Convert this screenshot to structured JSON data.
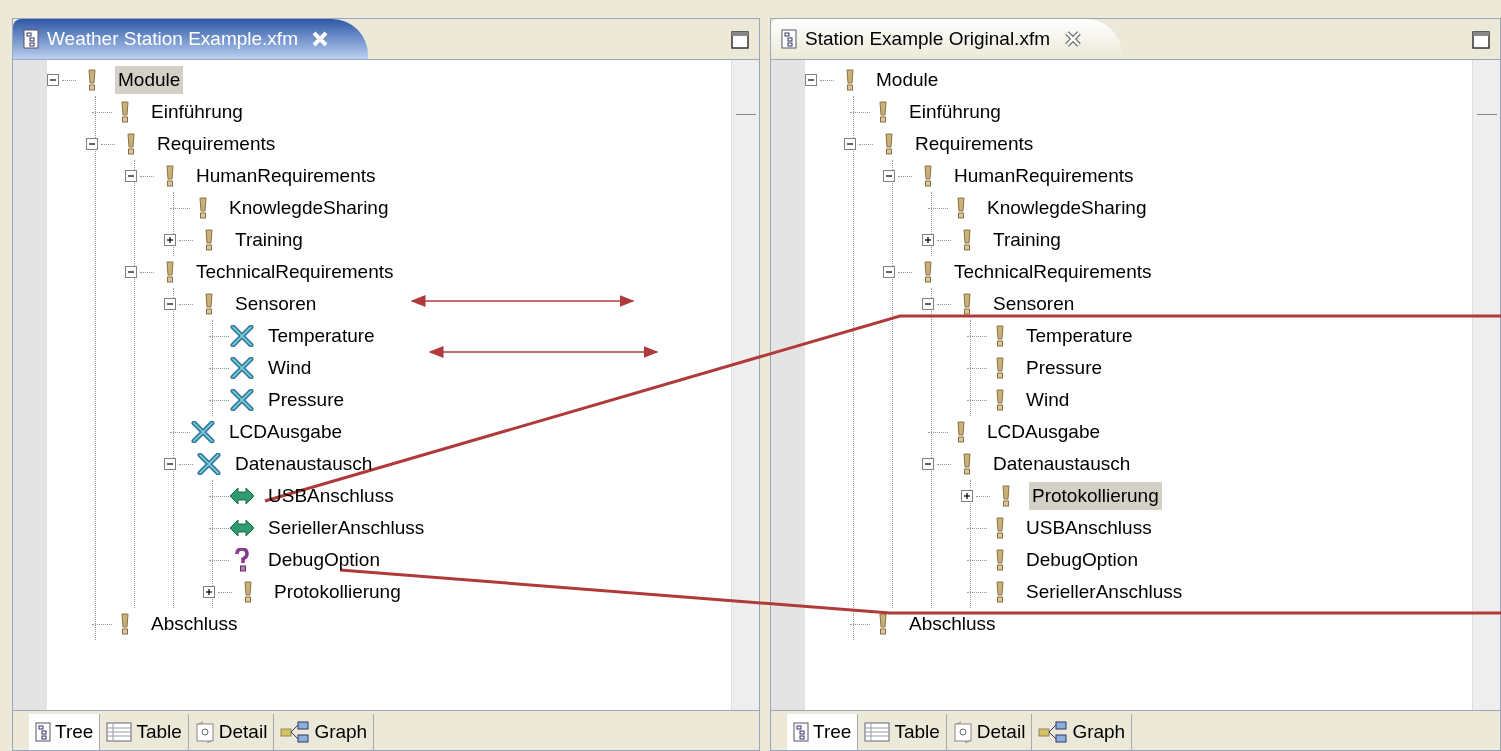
{
  "panels": [
    {
      "title": "Weather Station Example.xfm",
      "active": true,
      "tree": [
        {
          "label": "Module",
          "kind": "mandatory",
          "expanded": true,
          "selected": true,
          "children": [
            {
              "label": "Einführung",
              "kind": "mandatory",
              "selected": false
            },
            {
              "label": "Requirements",
              "kind": "mandatory",
              "expanded": true,
              "selected": false,
              "children": [
                {
                  "label": "HumanRequirements",
                  "kind": "mandatory",
                  "expanded": true,
                  "selected": false,
                  "children": [
                    {
                      "label": "KnowlegdeSharing",
                      "kind": "mandatory",
                      "selected": false
                    },
                    {
                      "label": "Training",
                      "kind": "mandatory",
                      "expanded": false,
                      "selected": false
                    }
                  ]
                },
                {
                  "label": "TechnicalRequirements",
                  "kind": "mandatory",
                  "expanded": true,
                  "selected": false,
                  "children": [
                    {
                      "label": "Sensoren",
                      "kind": "mandatory",
                      "expanded": true,
                      "selected": false,
                      "children": [
                        {
                          "label": "Temperature",
                          "kind": "removed",
                          "selected": false
                        },
                        {
                          "label": "Wind",
                          "kind": "removed",
                          "selected": false
                        },
                        {
                          "label": "Pressure",
                          "kind": "removed",
                          "selected": false
                        }
                      ]
                    },
                    {
                      "label": "LCDAusgabe",
                      "kind": "removed",
                      "selected": false
                    },
                    {
                      "label": "Datenaustausch",
                      "kind": "removed",
                      "expanded": true,
                      "selected": false,
                      "children": [
                        {
                          "label": "USBAnschluss",
                          "kind": "moved",
                          "selected": false
                        },
                        {
                          "label": "SeriellerAnschluss",
                          "kind": "moved",
                          "selected": false
                        },
                        {
                          "label": "DebugOption",
                          "kind": "optional",
                          "selected": false
                        },
                        {
                          "label": "Protokollierung",
                          "kind": "mandatory",
                          "expanded": false,
                          "selected": false
                        }
                      ]
                    }
                  ]
                }
              ]
            },
            {
              "label": "Abschluss",
              "kind": "mandatory",
              "selected": false
            }
          ]
        }
      ],
      "bottom_tabs": [
        {
          "label": "Tree",
          "selected": true
        },
        {
          "label": "Table",
          "selected": false
        },
        {
          "label": "Detail",
          "selected": false
        },
        {
          "label": "Graph",
          "selected": false
        }
      ]
    },
    {
      "title": "Station Example Original.xfm",
      "active": false,
      "tree": [
        {
          "label": "Module",
          "kind": "mandatory",
          "expanded": true,
          "selected": false,
          "children": [
            {
              "label": "Einführung",
              "kind": "mandatory",
              "selected": false
            },
            {
              "label": "Requirements",
              "kind": "mandatory",
              "expanded": true,
              "selected": false,
              "children": [
                {
                  "label": "HumanRequirements",
                  "kind": "mandatory",
                  "expanded": true,
                  "selected": false,
                  "children": [
                    {
                      "label": "KnowlegdeSharing",
                      "kind": "mandatory",
                      "selected": false
                    },
                    {
                      "label": "Training",
                      "kind": "mandatory",
                      "expanded": false,
                      "selected": false
                    }
                  ]
                },
                {
                  "label": "TechnicalRequirements",
                  "kind": "mandatory",
                  "expanded": true,
                  "selected": false,
                  "children": [
                    {
                      "label": "Sensoren",
                      "kind": "mandatory",
                      "expanded": true,
                      "selected": false,
                      "children": [
                        {
                          "label": "Temperature",
                          "kind": "mandatory",
                          "selected": false
                        },
                        {
                          "label": "Pressure",
                          "kind": "mandatory",
                          "selected": false
                        },
                        {
                          "label": "Wind",
                          "kind": "mandatory",
                          "selected": false
                        }
                      ]
                    },
                    {
                      "label": "LCDAusgabe",
                      "kind": "mandatory",
                      "selected": false
                    },
                    {
                      "label": "Datenaustausch",
                      "kind": "mandatory",
                      "expanded": true,
                      "selected": false,
                      "children": [
                        {
                          "label": "Protokollierung",
                          "kind": "mandatory",
                          "expanded": false,
                          "selected": true
                        },
                        {
                          "label": "USBAnschluss",
                          "kind": "mandatory",
                          "selected": false
                        },
                        {
                          "label": "DebugOption",
                          "kind": "mandatory",
                          "selected": false
                        },
                        {
                          "label": "SeriellerAnschluss",
                          "kind": "mandatory",
                          "selected": false
                        }
                      ]
                    }
                  ]
                }
              ]
            },
            {
              "label": "Abschluss",
              "kind": "mandatory",
              "selected": false
            }
          ]
        }
      ],
      "bottom_tabs": [
        {
          "label": "Tree",
          "selected": true
        },
        {
          "label": "Table",
          "selected": false
        },
        {
          "label": "Detail",
          "selected": false
        },
        {
          "label": "Graph",
          "selected": false
        }
      ]
    }
  ]
}
